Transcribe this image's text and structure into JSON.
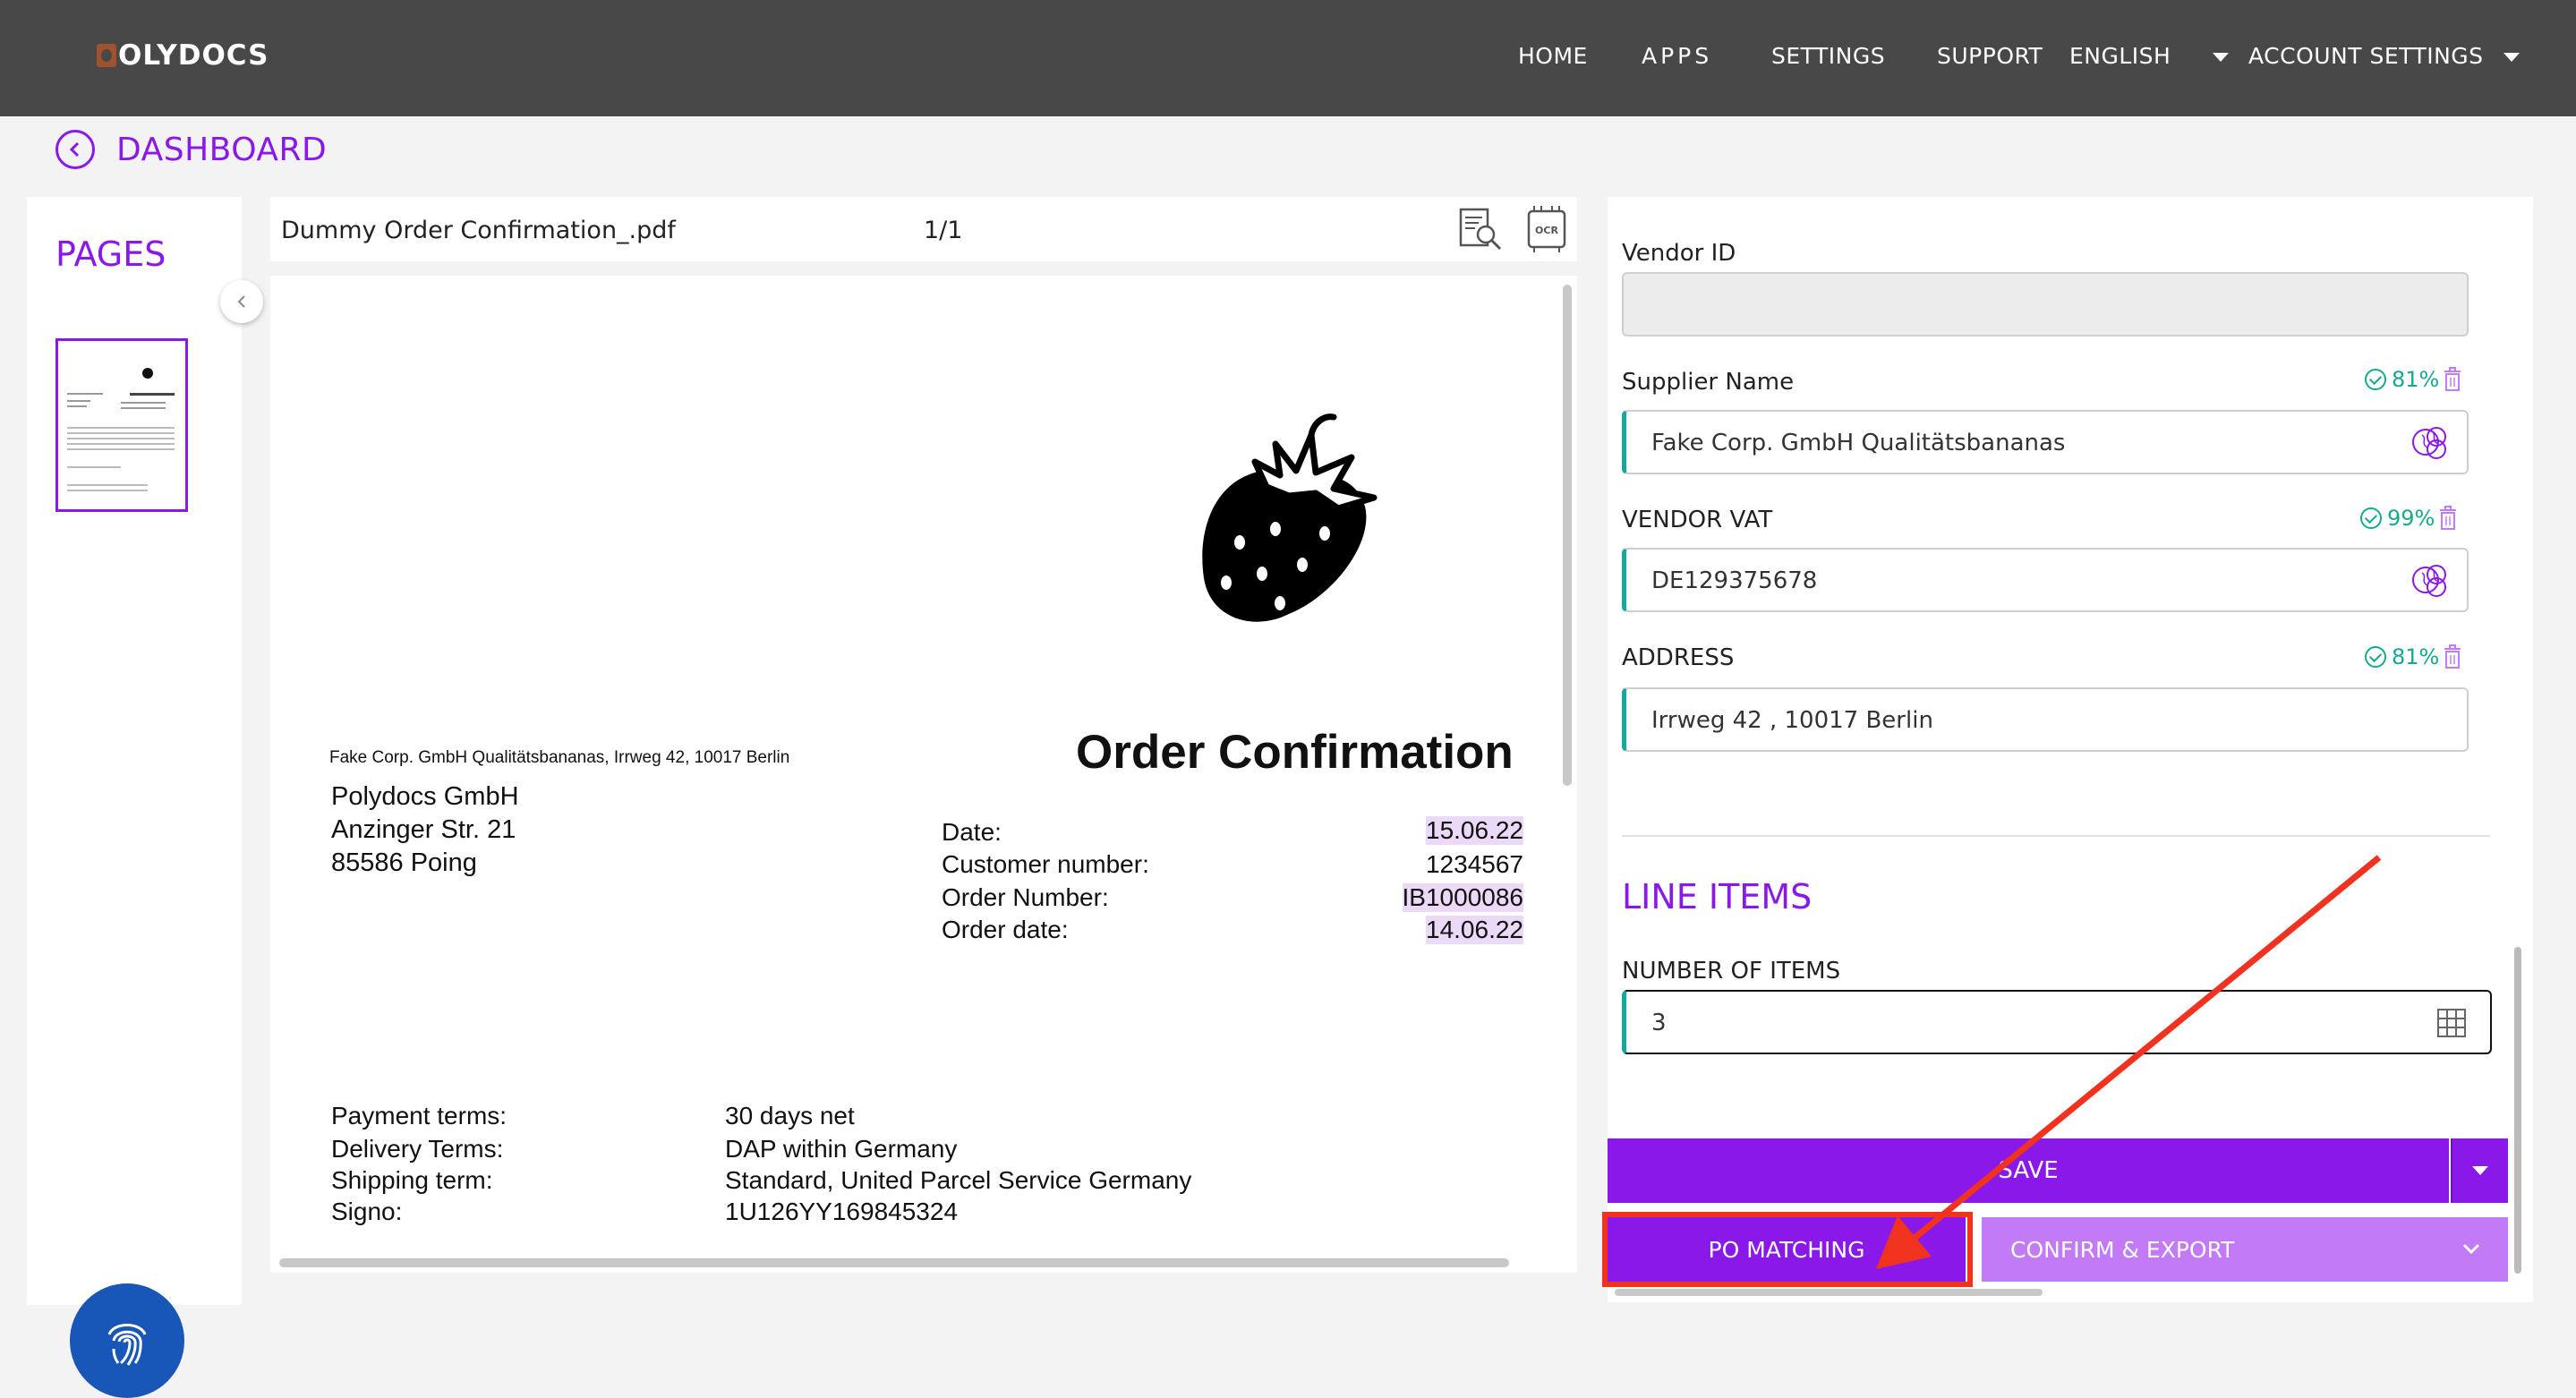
{
  "nav": {
    "logo": "OLYDOCS",
    "home": "HOME",
    "apps": "APPS",
    "settings": "SETTINGS",
    "support": "SUPPORT",
    "language": "ENGLISH",
    "account": "ACCOUNT SETTINGS"
  },
  "back": {
    "label": "DASHBOARD"
  },
  "pages": {
    "title": "PAGES"
  },
  "document": {
    "filename": "Dummy Order Confirmation_.pdf",
    "page_indicator": "1/1",
    "sender_line": "Fake Corp. GmbH Qualitätsbananas, Irrweg 42, 10017 Berlin",
    "heading": "Order Confirmation",
    "recipient": [
      "Polydocs GmbH",
      "Anzinger Str. 21",
      "85586 Poing"
    ],
    "meta": [
      {
        "label": "Date:",
        "value": "15.06.22",
        "highlight": true
      },
      {
        "label": "Customer number:",
        "value": "1234567",
        "highlight": false
      },
      {
        "label": "Order Number:",
        "value": "IB1000086",
        "highlight": true
      },
      {
        "label": "Order date:",
        "value": "14.06.22",
        "highlight": true
      }
    ],
    "terms": [
      {
        "label": "Payment terms:",
        "value": "30 days net"
      },
      {
        "label": "Delivery Terms:",
        "value": "DAP within Germany"
      },
      {
        "label": "Shipping term:",
        "value": "Standard, United Parcel Service Germany"
      },
      {
        "label": "Signo:",
        "value": "1U126YY169845324"
      }
    ]
  },
  "fields": {
    "vendor_id": {
      "label": "Vendor ID",
      "value": ""
    },
    "supplier_name": {
      "label": "Supplier Name",
      "value": "Fake Corp. GmbH Qualitätsbananas",
      "confidence": "81%"
    },
    "vendor_vat": {
      "label": "VENDOR VAT",
      "value": "DE129375678",
      "confidence": "99%"
    },
    "address": {
      "label": "ADDRESS",
      "value": "Irrweg 42 , 10017 Berlin",
      "confidence": "81%"
    }
  },
  "line_items": {
    "title": "LINE ITEMS",
    "count_label": "NUMBER OF ITEMS",
    "count_value": "3"
  },
  "actions": {
    "save": "SAVE",
    "po_matching": "PO MATCHING",
    "confirm_export": "CONFIRM & EXPORT"
  },
  "colors": {
    "accent": "#8a18e8",
    "navbar": "#484848",
    "teal": "#18a7a0",
    "annotation": "#f0321f",
    "fab": "#1856b8"
  }
}
